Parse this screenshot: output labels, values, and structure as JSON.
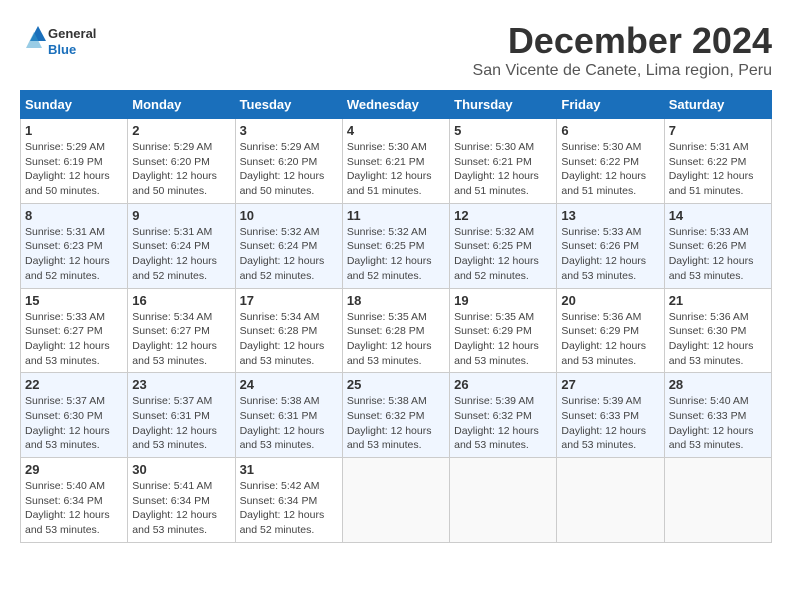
{
  "logo": {
    "text_general": "General",
    "text_blue": "Blue"
  },
  "title": {
    "month": "December 2024",
    "location": "San Vicente de Canete, Lima region, Peru"
  },
  "header_days": [
    "Sunday",
    "Monday",
    "Tuesday",
    "Wednesday",
    "Thursday",
    "Friday",
    "Saturday"
  ],
  "weeks": [
    [
      {
        "day": "1",
        "sunrise": "5:29 AM",
        "sunset": "6:19 PM",
        "daylight": "12 hours and 50 minutes."
      },
      {
        "day": "2",
        "sunrise": "5:29 AM",
        "sunset": "6:20 PM",
        "daylight": "12 hours and 50 minutes."
      },
      {
        "day": "3",
        "sunrise": "5:29 AM",
        "sunset": "6:20 PM",
        "daylight": "12 hours and 50 minutes."
      },
      {
        "day": "4",
        "sunrise": "5:30 AM",
        "sunset": "6:21 PM",
        "daylight": "12 hours and 51 minutes."
      },
      {
        "day": "5",
        "sunrise": "5:30 AM",
        "sunset": "6:21 PM",
        "daylight": "12 hours and 51 minutes."
      },
      {
        "day": "6",
        "sunrise": "5:30 AM",
        "sunset": "6:22 PM",
        "daylight": "12 hours and 51 minutes."
      },
      {
        "day": "7",
        "sunrise": "5:31 AM",
        "sunset": "6:22 PM",
        "daylight": "12 hours and 51 minutes."
      }
    ],
    [
      {
        "day": "8",
        "sunrise": "5:31 AM",
        "sunset": "6:23 PM",
        "daylight": "12 hours and 52 minutes."
      },
      {
        "day": "9",
        "sunrise": "5:31 AM",
        "sunset": "6:24 PM",
        "daylight": "12 hours and 52 minutes."
      },
      {
        "day": "10",
        "sunrise": "5:32 AM",
        "sunset": "6:24 PM",
        "daylight": "12 hours and 52 minutes."
      },
      {
        "day": "11",
        "sunrise": "5:32 AM",
        "sunset": "6:25 PM",
        "daylight": "12 hours and 52 minutes."
      },
      {
        "day": "12",
        "sunrise": "5:32 AM",
        "sunset": "6:25 PM",
        "daylight": "12 hours and 52 minutes."
      },
      {
        "day": "13",
        "sunrise": "5:33 AM",
        "sunset": "6:26 PM",
        "daylight": "12 hours and 53 minutes."
      },
      {
        "day": "14",
        "sunrise": "5:33 AM",
        "sunset": "6:26 PM",
        "daylight": "12 hours and 53 minutes."
      }
    ],
    [
      {
        "day": "15",
        "sunrise": "5:33 AM",
        "sunset": "6:27 PM",
        "daylight": "12 hours and 53 minutes."
      },
      {
        "day": "16",
        "sunrise": "5:34 AM",
        "sunset": "6:27 PM",
        "daylight": "12 hours and 53 minutes."
      },
      {
        "day": "17",
        "sunrise": "5:34 AM",
        "sunset": "6:28 PM",
        "daylight": "12 hours and 53 minutes."
      },
      {
        "day": "18",
        "sunrise": "5:35 AM",
        "sunset": "6:28 PM",
        "daylight": "12 hours and 53 minutes."
      },
      {
        "day": "19",
        "sunrise": "5:35 AM",
        "sunset": "6:29 PM",
        "daylight": "12 hours and 53 minutes."
      },
      {
        "day": "20",
        "sunrise": "5:36 AM",
        "sunset": "6:29 PM",
        "daylight": "12 hours and 53 minutes."
      },
      {
        "day": "21",
        "sunrise": "5:36 AM",
        "sunset": "6:30 PM",
        "daylight": "12 hours and 53 minutes."
      }
    ],
    [
      {
        "day": "22",
        "sunrise": "5:37 AM",
        "sunset": "6:30 PM",
        "daylight": "12 hours and 53 minutes."
      },
      {
        "day": "23",
        "sunrise": "5:37 AM",
        "sunset": "6:31 PM",
        "daylight": "12 hours and 53 minutes."
      },
      {
        "day": "24",
        "sunrise": "5:38 AM",
        "sunset": "6:31 PM",
        "daylight": "12 hours and 53 minutes."
      },
      {
        "day": "25",
        "sunrise": "5:38 AM",
        "sunset": "6:32 PM",
        "daylight": "12 hours and 53 minutes."
      },
      {
        "day": "26",
        "sunrise": "5:39 AM",
        "sunset": "6:32 PM",
        "daylight": "12 hours and 53 minutes."
      },
      {
        "day": "27",
        "sunrise": "5:39 AM",
        "sunset": "6:33 PM",
        "daylight": "12 hours and 53 minutes."
      },
      {
        "day": "28",
        "sunrise": "5:40 AM",
        "sunset": "6:33 PM",
        "daylight": "12 hours and 53 minutes."
      }
    ],
    [
      {
        "day": "29",
        "sunrise": "5:40 AM",
        "sunset": "6:34 PM",
        "daylight": "12 hours and 53 minutes."
      },
      {
        "day": "30",
        "sunrise": "5:41 AM",
        "sunset": "6:34 PM",
        "daylight": "12 hours and 53 minutes."
      },
      {
        "day": "31",
        "sunrise": "5:42 AM",
        "sunset": "6:34 PM",
        "daylight": "12 hours and 52 minutes."
      },
      null,
      null,
      null,
      null
    ]
  ],
  "labels": {
    "sunrise": "Sunrise:",
    "sunset": "Sunset:",
    "daylight": "Daylight:"
  },
  "accent_color": "#1a6fbb"
}
